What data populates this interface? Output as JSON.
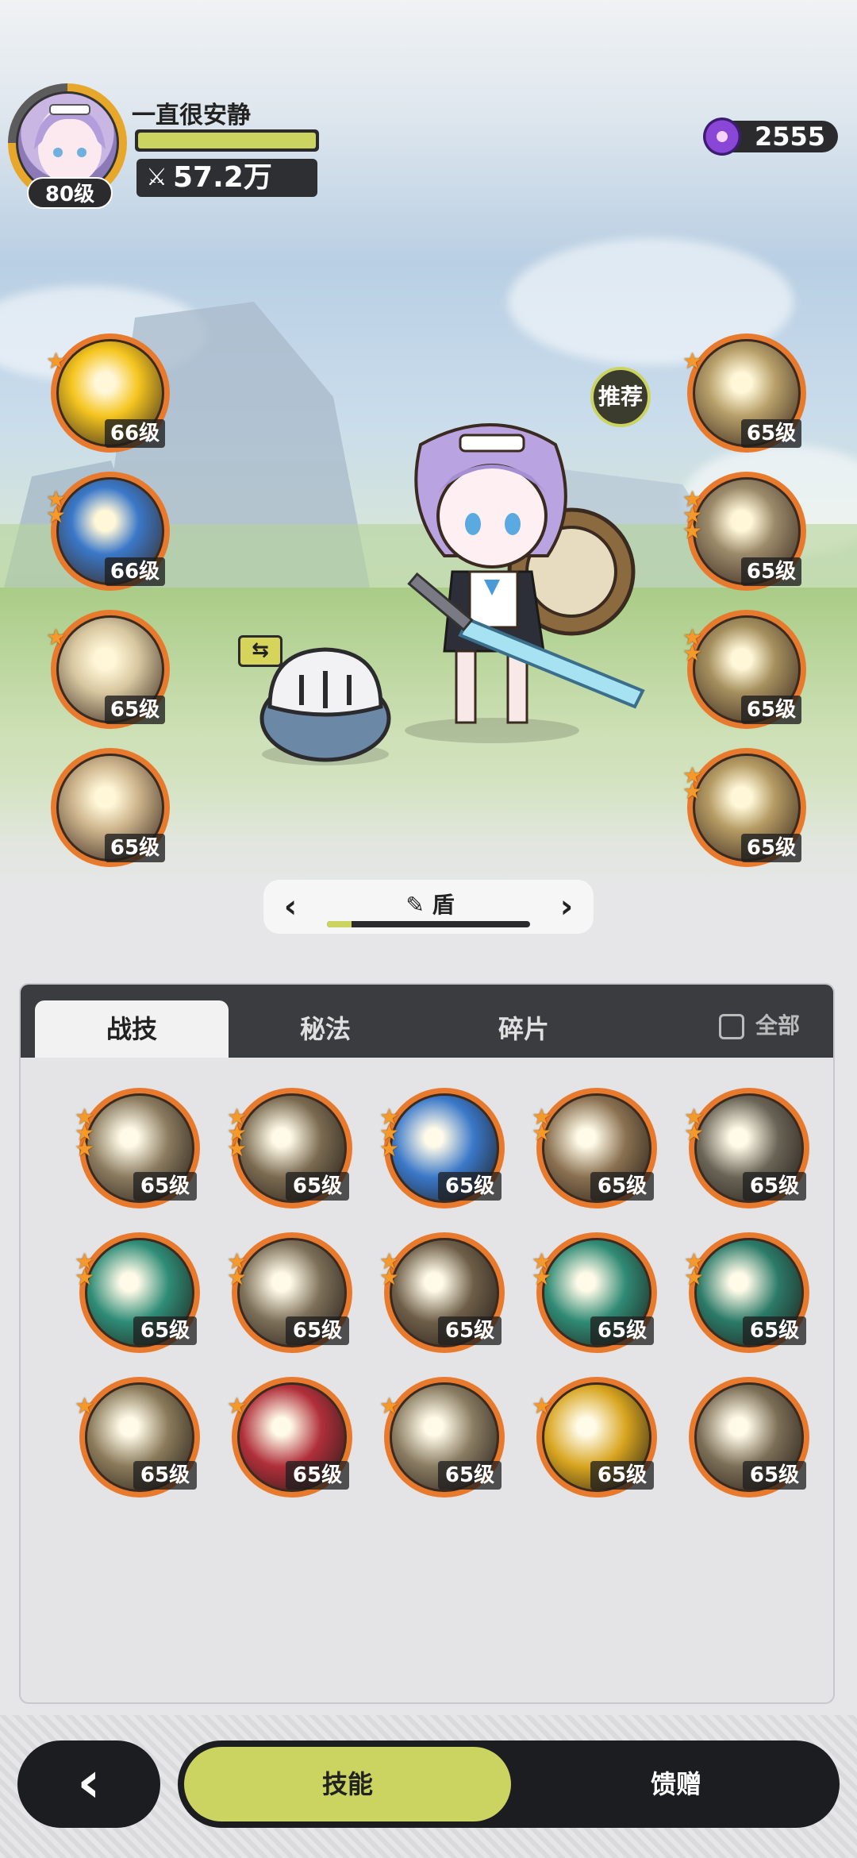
{
  "player": {
    "name": "一直很安静",
    "level": "80级",
    "power": "57.2万",
    "exp_progress": 1.0
  },
  "currency": {
    "amount": "2555",
    "icon": "purple-gem-icon"
  },
  "recommend_label": "推荐",
  "left_slots": [
    {
      "level": "66级",
      "stars": 1,
      "theme": "gold-shield",
      "color": "#f5c51f"
    },
    {
      "level": "66级",
      "stars": 2,
      "theme": "blue-ring",
      "color": "#3a78c8"
    },
    {
      "level": "65级",
      "stars": 1,
      "theme": "cream-burst",
      "color": "#d8c7a0"
    },
    {
      "level": "65级",
      "stars": 0,
      "theme": "cream-sword",
      "color": "#cdb48c"
    }
  ],
  "right_slots": [
    {
      "level": "65级",
      "stars": 1,
      "theme": "bronze-figures",
      "color": "#b8a06a"
    },
    {
      "level": "65级",
      "stars": 3,
      "theme": "bronze-swirl",
      "color": "#9b8a6a"
    },
    {
      "level": "65级",
      "stars": 2,
      "theme": "bronze-beast",
      "color": "#a6905f"
    },
    {
      "level": "65级",
      "stars": 2,
      "theme": "bronze-armor",
      "color": "#b49a63"
    }
  ],
  "weapon": {
    "name": "盾",
    "prev_icon": "chevron-left-icon",
    "next_icon": "chevron-right-icon",
    "progress": 0.12
  },
  "tabs": [
    {
      "label": "战技",
      "active": true
    },
    {
      "label": "秘法",
      "active": false
    },
    {
      "label": "碎片",
      "active": false
    }
  ],
  "all_label": "全部",
  "skills": [
    {
      "level": "65级",
      "stars": 3,
      "color": "#8a7a5e"
    },
    {
      "level": "65级",
      "stars": 3,
      "color": "#7a6a50"
    },
    {
      "level": "65级",
      "stars": 3,
      "color": "#3a78c8"
    },
    {
      "level": "65级",
      "stars": 2,
      "color": "#8a7050"
    },
    {
      "level": "65级",
      "stars": 2,
      "color": "#6a6456"
    },
    {
      "level": "65级",
      "stars": 2,
      "color": "#2e8c76"
    },
    {
      "level": "65级",
      "stars": 2,
      "color": "#7d6f58"
    },
    {
      "level": "65级",
      "stars": 2,
      "color": "#6e5e48"
    },
    {
      "level": "65级",
      "stars": 2,
      "color": "#2f8a74"
    },
    {
      "level": "65级",
      "stars": 2,
      "color": "#2b7a68"
    },
    {
      "level": "65级",
      "stars": 1,
      "color": "#8a7a5a"
    },
    {
      "level": "65级",
      "stars": 1,
      "color": "#b02f3a"
    },
    {
      "level": "65级",
      "stars": 1,
      "color": "#8a7c62"
    },
    {
      "level": "65级",
      "stars": 1,
      "color": "#d8a520"
    },
    {
      "level": "65级",
      "stars": 0,
      "color": "#7c6e56"
    }
  ],
  "bottom": {
    "back_icon": "chevron-left-icon",
    "skill_tab": "技能",
    "gift_tab": "馈赠"
  }
}
